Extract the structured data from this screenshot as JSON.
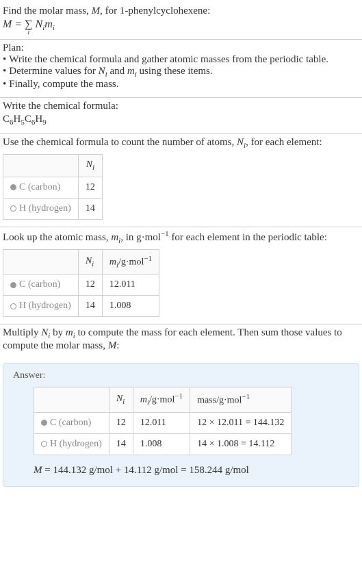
{
  "intro": {
    "line1_prefix": "Find the molar mass, ",
    "line1_var": "M",
    "line1_suffix": ", for 1-phenylcyclohexene:",
    "formula_M": "M",
    "formula_eq": " = ",
    "formula_N": "N",
    "formula_m": "m"
  },
  "plan": {
    "title": "Plan:",
    "items": [
      "Write the chemical formula and gather atomic masses from the periodic table.",
      "Determine values for ",
      "Finally, compute the mass."
    ],
    "item2_mid": " and ",
    "item2_suffix": " using these items."
  },
  "chemFormula": {
    "title": "Write the chemical formula:",
    "c": "C",
    "h": "H",
    "s1": "6",
    "s2": "5",
    "s3": "6",
    "s4": "9"
  },
  "countSection": {
    "text_prefix": "Use the chemical formula to count the number of atoms, ",
    "text_suffix": ", for each element:",
    "header_N": "N",
    "rows": [
      {
        "label": "C (carbon)",
        "n": "12"
      },
      {
        "label": "H (hydrogen)",
        "n": "14"
      }
    ]
  },
  "massSection": {
    "text_prefix": "Look up the atomic mass, ",
    "text_mid": ", in g·mol",
    "text_suffix": " for each element in the periodic table:",
    "header_N": "N",
    "header_m_prefix": "m",
    "header_m_unit": "/g·mol",
    "neg1": "−1",
    "rows": [
      {
        "label": "C (carbon)",
        "n": "12",
        "m": "12.011"
      },
      {
        "label": "H (hydrogen)",
        "n": "14",
        "m": "1.008"
      }
    ]
  },
  "multiplySection": {
    "text_p1": "Multiply ",
    "text_p2": " by ",
    "text_p3": " to compute the mass for each element. Then sum those values to compute the molar mass, ",
    "text_p4": ":"
  },
  "answer": {
    "title": "Answer:",
    "header_N": "N",
    "header_m_prefix": "m",
    "header_m_unit": "/g·mol",
    "header_mass_prefix": "mass/g·mol",
    "neg1": "−1",
    "rows": [
      {
        "label": "C (carbon)",
        "n": "12",
        "m": "12.011",
        "mass": "12 × 12.011 = 144.132"
      },
      {
        "label": "H (hydrogen)",
        "n": "14",
        "m": "1.008",
        "mass": "14 × 1.008 = 14.112"
      }
    ],
    "final_M": "M",
    "final_eq": " = 144.132 g/mol + 14.112 g/mol = 158.244 g/mol"
  },
  "chart_data": {
    "type": "table",
    "title": "Molar mass of 1-phenylcyclohexene",
    "compound": "C6H5C6H9",
    "elements": [
      {
        "element": "C (carbon)",
        "N_i": 12,
        "m_i_g_per_mol": 12.011,
        "mass_g_per_mol": 144.132
      },
      {
        "element": "H (hydrogen)",
        "N_i": 14,
        "m_i_g_per_mol": 1.008,
        "mass_g_per_mol": 14.112
      }
    ],
    "molar_mass_g_per_mol": 158.244
  }
}
